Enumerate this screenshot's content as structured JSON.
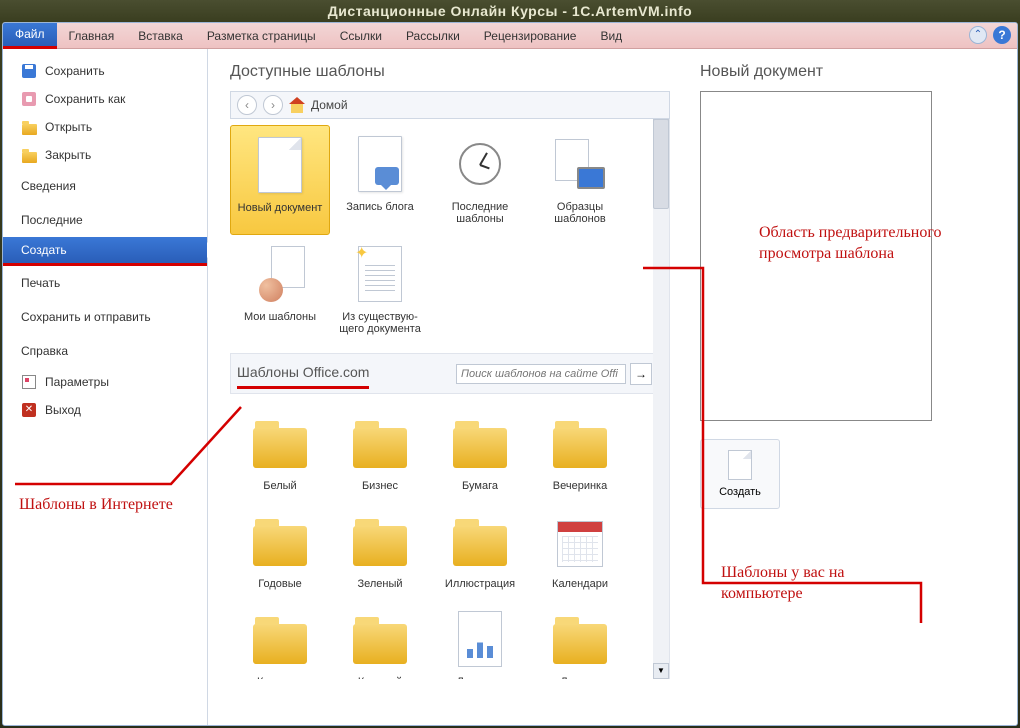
{
  "window_title": "Дистанционные Онлайн Курсы - 1C.ArtemVM.info",
  "ribbon": {
    "file": "Файл",
    "home": "Главная",
    "insert": "Вставка",
    "layout": "Разметка страницы",
    "links": "Ссылки",
    "mailings": "Рассылки",
    "review": "Рецензирование",
    "view": "Вид"
  },
  "sidebar": {
    "save": "Сохранить",
    "save_as": "Сохранить как",
    "open": "Открыть",
    "close": "Закрыть",
    "info": "Сведения",
    "recent": "Последние",
    "new": "Создать",
    "print": "Печать",
    "save_send": "Сохранить и отправить",
    "help": "Справка",
    "options": "Параметры",
    "exit": "Выход"
  },
  "templates": {
    "heading": "Доступные шаблоны",
    "home": "Домой",
    "items": [
      {
        "label": "Новый документ"
      },
      {
        "label": "Запись блога"
      },
      {
        "label": "Последние шаблоны"
      },
      {
        "label": "Образцы шаблонов"
      },
      {
        "label": "Мои шаблоны"
      },
      {
        "label": "Из существую-\nщего документа"
      }
    ],
    "office_section": "Шаблоны Office.com",
    "search_placeholder": "Поиск шаблонов на сайте Offi",
    "folders": [
      "Белый",
      "Бизнес",
      "Бумага",
      "Вечеринка",
      "Годовые",
      "Зеленый",
      "Иллюстрация",
      "Календари",
      "Карточки",
      "Красный",
      "Листовки",
      "Личные"
    ]
  },
  "preview": {
    "heading": "Новый документ",
    "create": "Создать"
  },
  "annotations": {
    "internet": "Шаблоны в Интернете",
    "computer": "Шаблоны у вас на компьютере",
    "previewbox": "Область предварительного просмотра шаблона"
  }
}
